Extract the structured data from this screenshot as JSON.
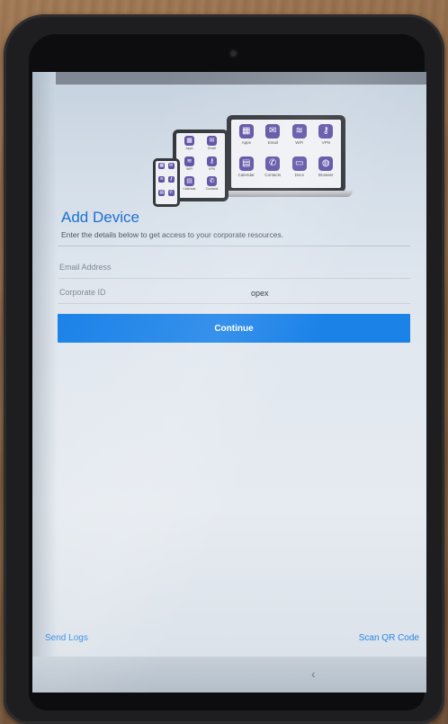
{
  "header": {
    "illustration": {
      "laptop_apps": [
        {
          "label": "Apps",
          "icon": "grid-icon",
          "glyph": "▦"
        },
        {
          "label": "Email",
          "icon": "mail-icon",
          "glyph": "✉"
        },
        {
          "label": "WiFi",
          "icon": "wifi-icon",
          "glyph": "≋"
        },
        {
          "label": "VPN",
          "icon": "key-icon",
          "glyph": "⚷"
        },
        {
          "label": "Calendar",
          "icon": "calendar-icon",
          "glyph": "▤"
        },
        {
          "label": "Contacts",
          "icon": "phone-icon",
          "glyph": "✆"
        },
        {
          "label": "Docs",
          "icon": "doc-icon",
          "glyph": "▭"
        },
        {
          "label": "Browser",
          "icon": "globe-icon",
          "glyph": "◍"
        }
      ],
      "tablet_apps": [
        {
          "label": "Apps",
          "icon": "grid-icon",
          "glyph": "▦"
        },
        {
          "label": "Email",
          "icon": "mail-icon",
          "glyph": "✉"
        },
        {
          "label": "WiFi",
          "icon": "wifi-icon",
          "glyph": "≋"
        },
        {
          "label": "VPN",
          "icon": "key-icon",
          "glyph": "⚷"
        },
        {
          "label": "Calendar",
          "icon": "calendar-icon",
          "glyph": "▤"
        },
        {
          "label": "Contacts",
          "icon": "phone-icon",
          "glyph": "✆"
        }
      ],
      "phone_apps": [
        {
          "label": "Apps",
          "icon": "grid-icon",
          "glyph": "▦"
        },
        {
          "label": "Email",
          "icon": "mail-icon",
          "glyph": "✉"
        },
        {
          "label": "WiFi",
          "icon": "wifi-icon",
          "glyph": "≋"
        },
        {
          "label": "VPN",
          "icon": "key-icon",
          "glyph": "⚷"
        },
        {
          "label": "Calendar",
          "icon": "calendar-icon",
          "glyph": "▤"
        },
        {
          "label": "Contacts",
          "icon": "phone-icon",
          "glyph": "✆"
        }
      ]
    }
  },
  "form": {
    "title": "Add Device",
    "subtitle": "Enter the details below to get access to your corporate resources.",
    "email": {
      "label": "Email Address",
      "value": ""
    },
    "corporate_id": {
      "label": "Corporate ID",
      "value": "opex"
    },
    "continue_label": "Continue"
  },
  "footer": {
    "send_logs": "Send Logs",
    "scan_qr": "Scan QR Code"
  },
  "navbar": {
    "back_icon": "chevron-left-icon",
    "back_glyph": "‹"
  },
  "colors": {
    "accent": "#1b82e8",
    "title": "#1b6fcf",
    "link": "#2a86e6",
    "app_tile": "#5b4ea3"
  }
}
